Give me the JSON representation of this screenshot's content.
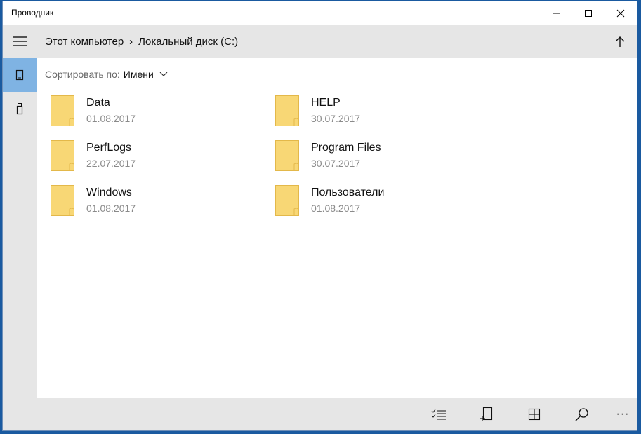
{
  "window": {
    "title": "Проводник"
  },
  "breadcrumb": {
    "items": [
      "Этот компьютер",
      "Локальный диск (C:)"
    ],
    "separator": "›"
  },
  "sort": {
    "label": "Сортировать по:",
    "value": "Имени"
  },
  "items": [
    {
      "name": "Data",
      "date": "01.08.2017"
    },
    {
      "name": "HELP",
      "date": "30.07.2017"
    },
    {
      "name": "PerfLogs",
      "date": "22.07.2017"
    },
    {
      "name": "Program Files",
      "date": "30.07.2017"
    },
    {
      "name": "Windows",
      "date": "01.08.2017"
    },
    {
      "name": "Пользователи",
      "date": "01.08.2017"
    }
  ],
  "colors": {
    "accent": "#7fb3e3",
    "folder": "#f8d775",
    "folder_edge": "#e3b84a",
    "chrome": "#e6e6e6"
  },
  "toolbar": {
    "icons": [
      "select-icon",
      "new-window-icon",
      "view-tiles-icon",
      "search-icon",
      "more-icon"
    ],
    "more_label": "···"
  }
}
